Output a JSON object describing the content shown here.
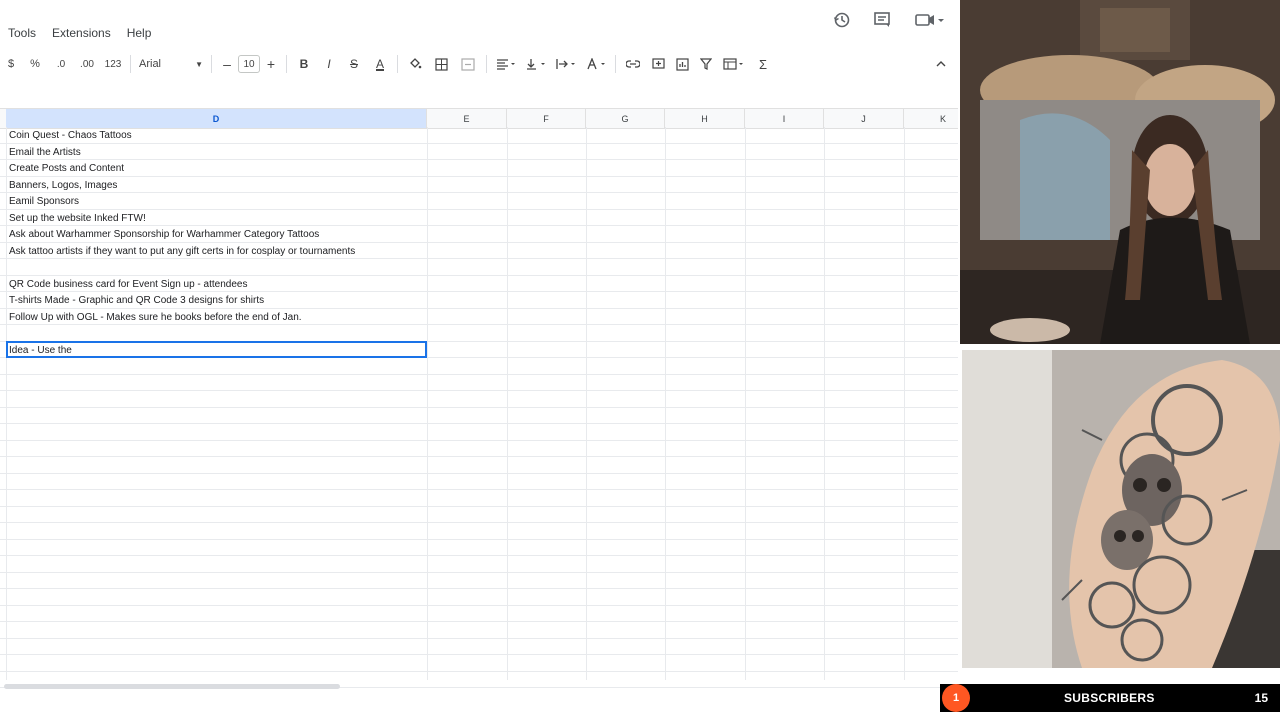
{
  "menu": [
    "Tools",
    "Extensions",
    "Help"
  ],
  "toolbar": {
    "currency": "$",
    "percent": "%",
    "dec_decrease": ".0",
    "dec_increase": ".00",
    "format_more": "123",
    "font": "Arial",
    "font_size": "10",
    "minus": "–",
    "plus": "+",
    "bold": "B",
    "italic": "I",
    "strike": "S",
    "text_color": "A",
    "sum": "Σ"
  },
  "columns": [
    {
      "label": "D",
      "selected": true
    },
    {
      "label": "E",
      "selected": false
    },
    {
      "label": "F",
      "selected": false
    },
    {
      "label": "G",
      "selected": false
    },
    {
      "label": "H",
      "selected": false
    },
    {
      "label": "I",
      "selected": false
    },
    {
      "label": "J",
      "selected": false
    },
    {
      "label": "K",
      "selected": false
    }
  ],
  "cells": [
    "Coin Quest - Chaos Tattoos",
    "Email the Artists",
    "Create Posts and Content",
    "Banners, Logos, Images",
    "Eamil Sponsors",
    "Set up the website Inked FTW!",
    "Ask about Warhammer Sponsorship for Warhammer Category Tattoos",
    "Ask tattoo artists if they want to put any gift certs in for cosplay or tournaments",
    "",
    "QR Code business card for Event Sign up - attendees",
    "T-shirts Made - Graphic and QR Code 3 designs for shirts",
    "Follow Up with OGL - Makes sure he books before the end of Jan.",
    ""
  ],
  "active_cell": {
    "value": "Idea - Use the"
  },
  "stream_overlay": {
    "badge": "1",
    "label": "SUBSCRIBERS",
    "count": "15"
  },
  "colors": {
    "accent": "#1a73e8",
    "selected_header": "#d3e3fd",
    "badge": "#ff5722"
  }
}
